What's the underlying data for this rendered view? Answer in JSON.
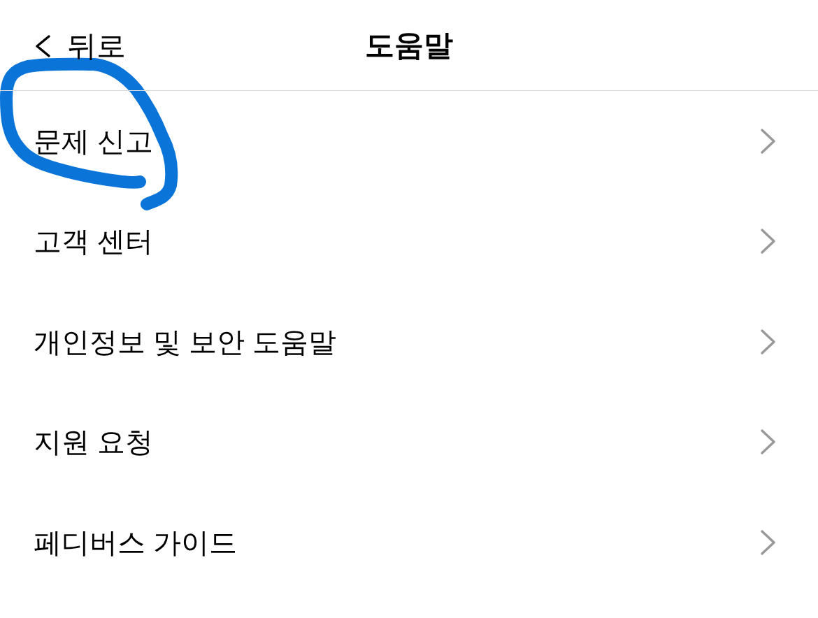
{
  "header": {
    "back": {
      "label": "뒤로"
    },
    "title": "도움말"
  },
  "items": [
    {
      "label": "문제 신고",
      "circled": true
    },
    {
      "label": "고객 센터",
      "circled": false
    },
    {
      "label": "개인정보 및 보안 도움말",
      "circled": false
    },
    {
      "label": "지원 요청",
      "circled": false
    },
    {
      "label": "페디버스 가이드",
      "circled": false
    }
  ]
}
